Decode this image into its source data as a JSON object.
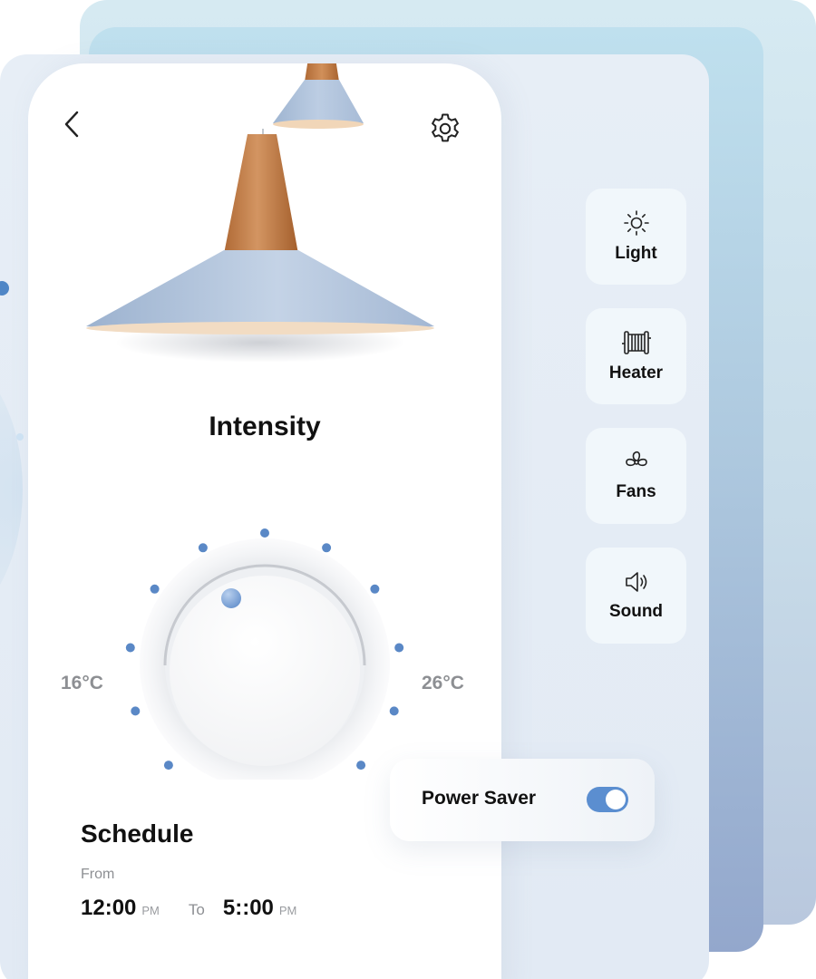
{
  "header": {
    "back_icon": "chevron-left-icon",
    "settings_icon": "gear-icon"
  },
  "intensity": {
    "title": "Intensity",
    "min_label": "16°C",
    "max_label": "26°C"
  },
  "side_menu": [
    {
      "label": "Light",
      "icon": "sun-icon"
    },
    {
      "label": "Heater",
      "icon": "radiator-icon"
    },
    {
      "label": "Fans",
      "icon": "fan-icon"
    },
    {
      "label": "Sound",
      "icon": "speaker-icon"
    }
  ],
  "power_saver": {
    "label": "Power Saver",
    "enabled": true
  },
  "schedule": {
    "title": "Schedule",
    "from_label": "From",
    "from_time": "12:00",
    "from_ampm": "PM",
    "to_label": "To",
    "to_time": "5::00",
    "to_ampm": "PM"
  },
  "colors": {
    "accent": "#5b8ed0",
    "dot": "#5a88c6",
    "card": "#ffffff",
    "tile": "#f1f7fb"
  }
}
